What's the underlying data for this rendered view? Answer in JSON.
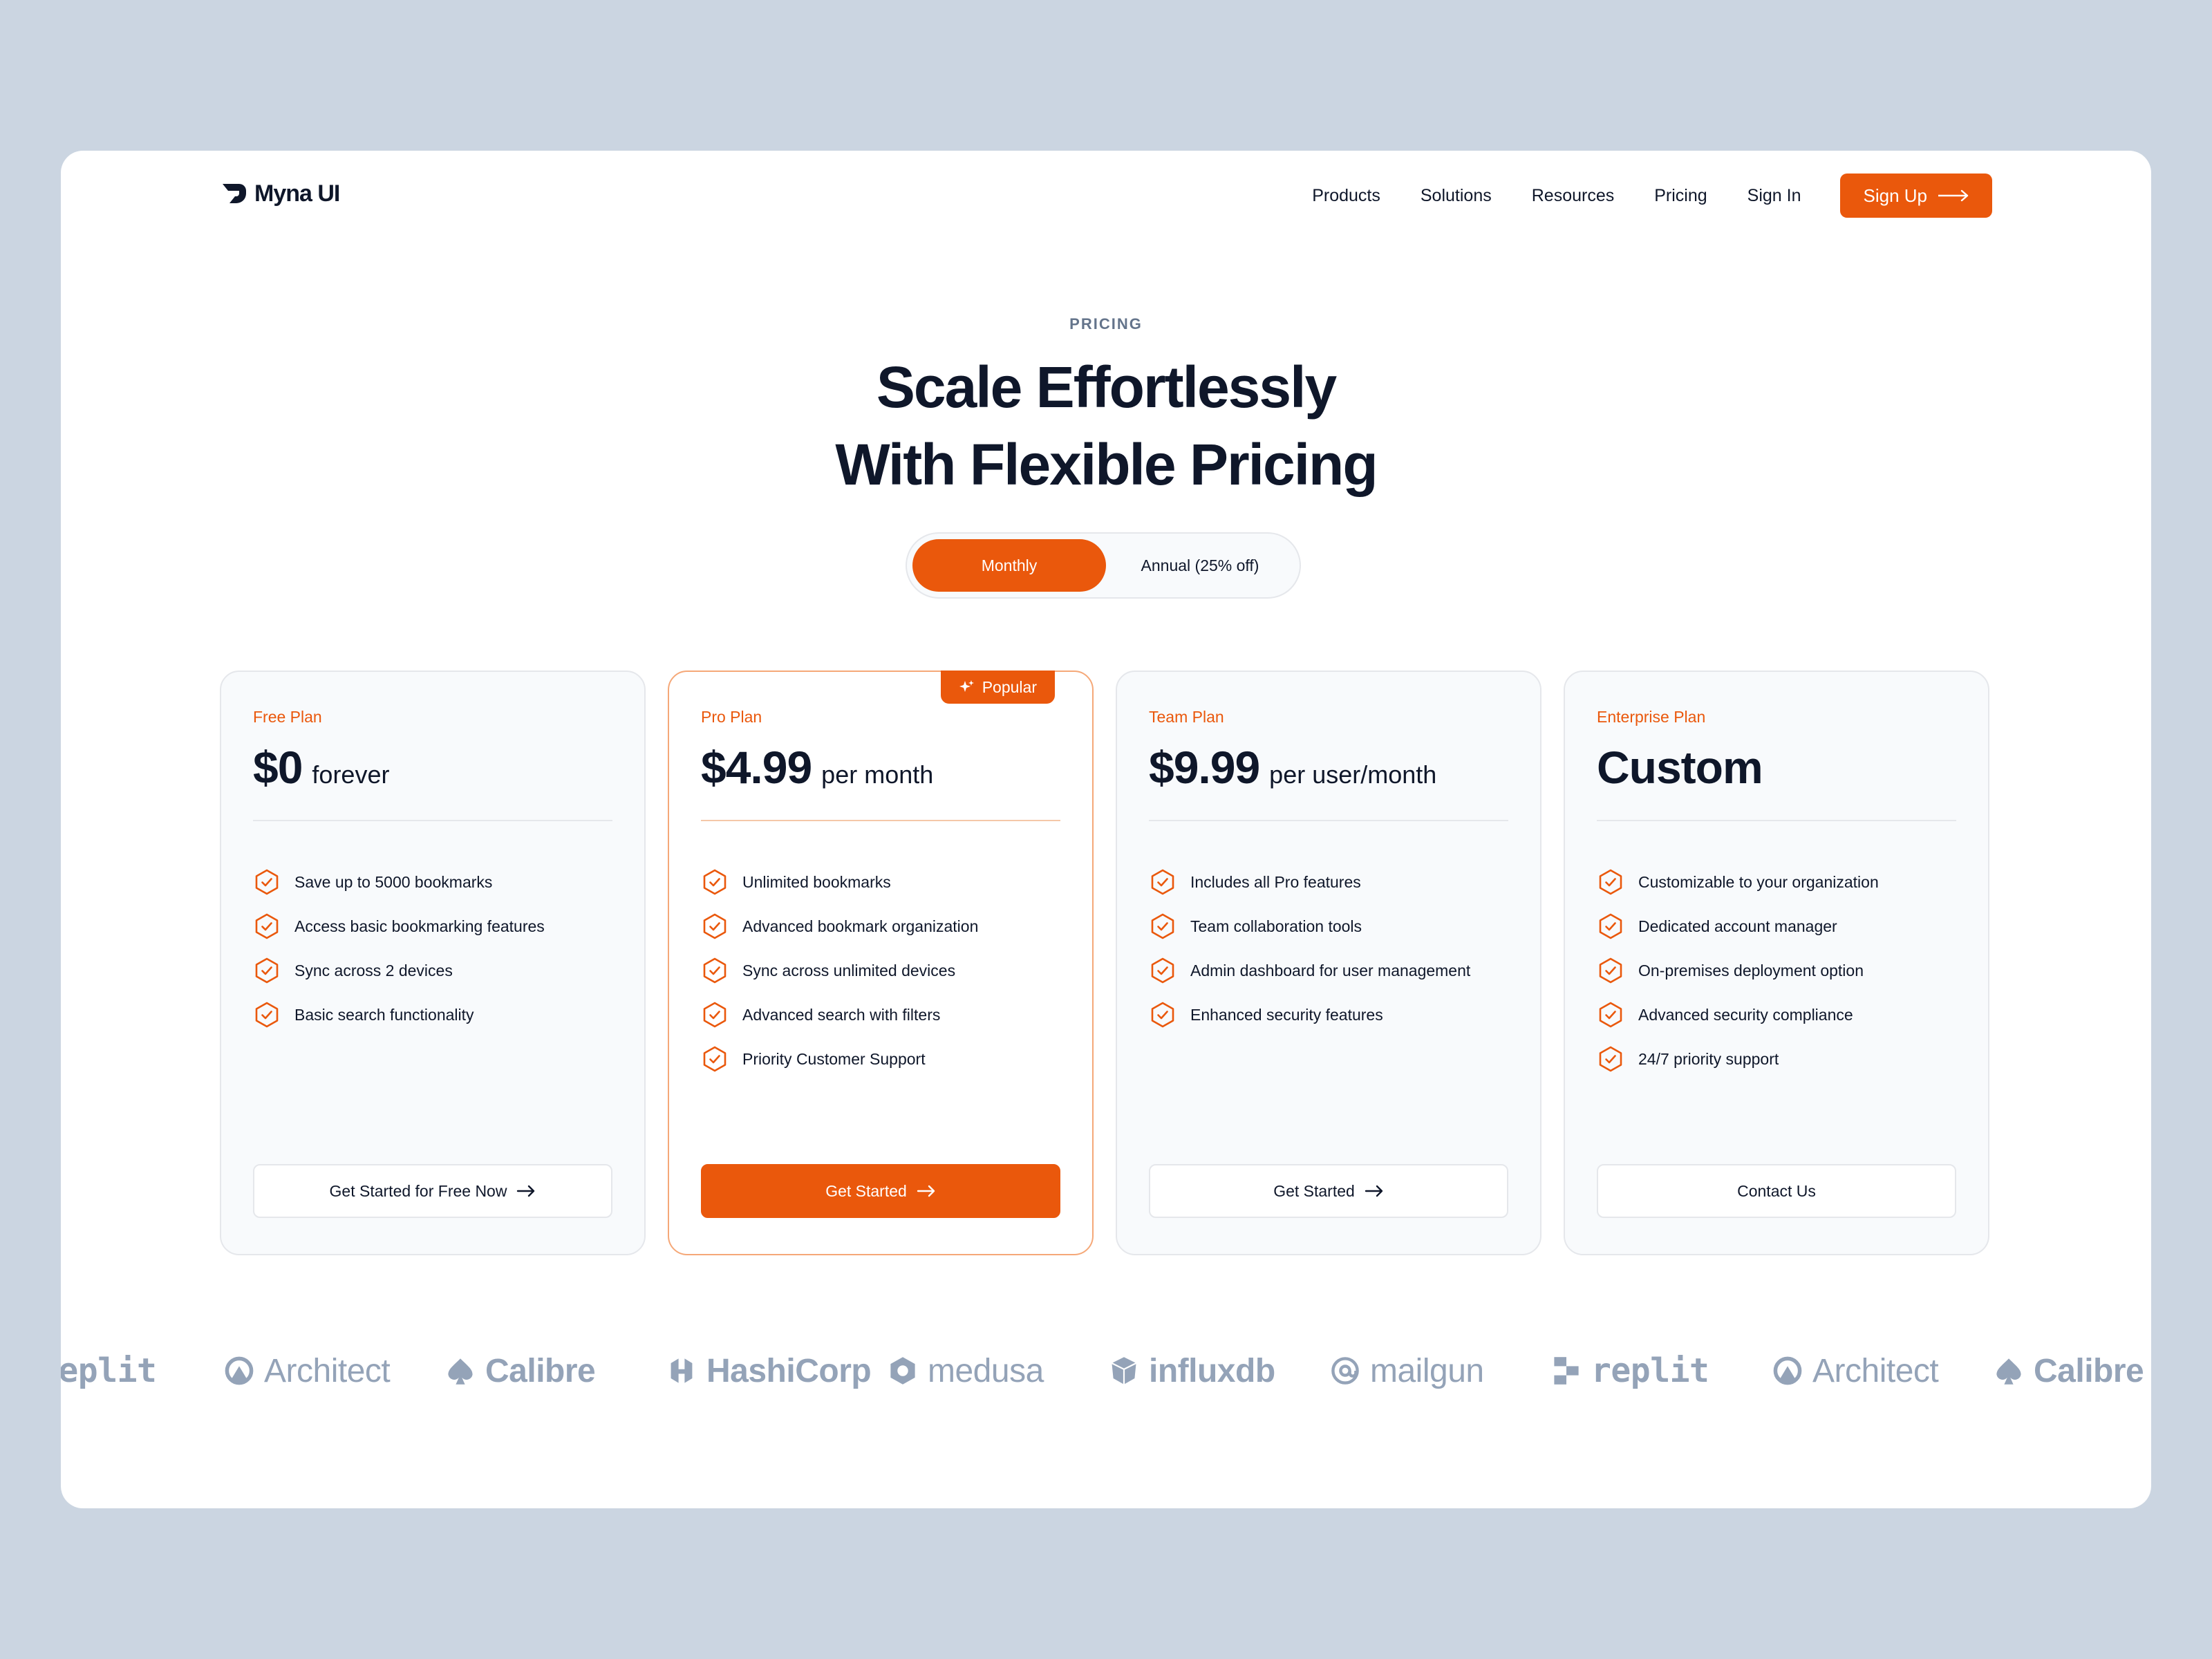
{
  "brand": {
    "name": "Myna UI",
    "accent": "#ea580c"
  },
  "nav": {
    "links": [
      "Products",
      "Solutions",
      "Resources",
      "Pricing",
      "Sign In"
    ],
    "signup_label": "Sign Up"
  },
  "hero": {
    "eyebrow": "PRICING",
    "headline_line1": "Scale Effortlessly",
    "headline_line2": "With Flexible Pricing"
  },
  "billing_toggle": {
    "options": [
      "Monthly",
      "Annual (25% off)"
    ],
    "selected": "Monthly"
  },
  "plans": [
    {
      "name": "Free Plan",
      "price": "$0",
      "period": "forever",
      "features": [
        "Save up to 5000 bookmarks",
        "Access basic bookmarking features",
        "Sync across 2 devices",
        "Basic search functionality"
      ],
      "cta": "Get Started for Free Now",
      "cta_arrow": true,
      "highlighted": false
    },
    {
      "name": "Pro Plan",
      "price": "$4.99",
      "period": "per month",
      "badge": "Popular",
      "features": [
        "Unlimited bookmarks",
        "Advanced bookmark organization",
        "Sync across unlimited devices",
        "Advanced search with filters",
        "Priority Customer Support"
      ],
      "cta": "Get Started",
      "cta_arrow": true,
      "highlighted": true
    },
    {
      "name": "Team Plan",
      "price": "$9.99",
      "period": "per user/month",
      "features": [
        "Includes all Pro features",
        "Team collaboration tools",
        "Admin dashboard for user management",
        "Enhanced security features"
      ],
      "cta": "Get Started",
      "cta_arrow": true,
      "highlighted": false
    },
    {
      "name": "Enterprise Plan",
      "price": "Custom",
      "period": "",
      "features": [
        "Customizable to your organization",
        "Dedicated account manager",
        "On-premises deployment option",
        "Advanced security compliance",
        "24/7 priority support"
      ],
      "cta": "Contact Us",
      "cta_arrow": false,
      "highlighted": false
    }
  ],
  "logo_strip": [
    {
      "name": "replit",
      "icon": "replit-icon"
    },
    {
      "name": "Architect",
      "icon": "architect-icon"
    },
    {
      "name": "Calibre",
      "icon": "spade-icon"
    },
    {
      "name": "HashiCorp",
      "icon": "hashicorp-icon"
    },
    {
      "name": "medusa",
      "icon": "hexagon-icon"
    },
    {
      "name": "influxdb",
      "icon": "cube-icon"
    },
    {
      "name": "mailgun",
      "icon": "at-icon"
    },
    {
      "name": "replit",
      "icon": "replit-icon"
    },
    {
      "name": "Architect",
      "icon": "architect-icon"
    },
    {
      "name": "Calibre",
      "icon": "spade-icon"
    }
  ]
}
